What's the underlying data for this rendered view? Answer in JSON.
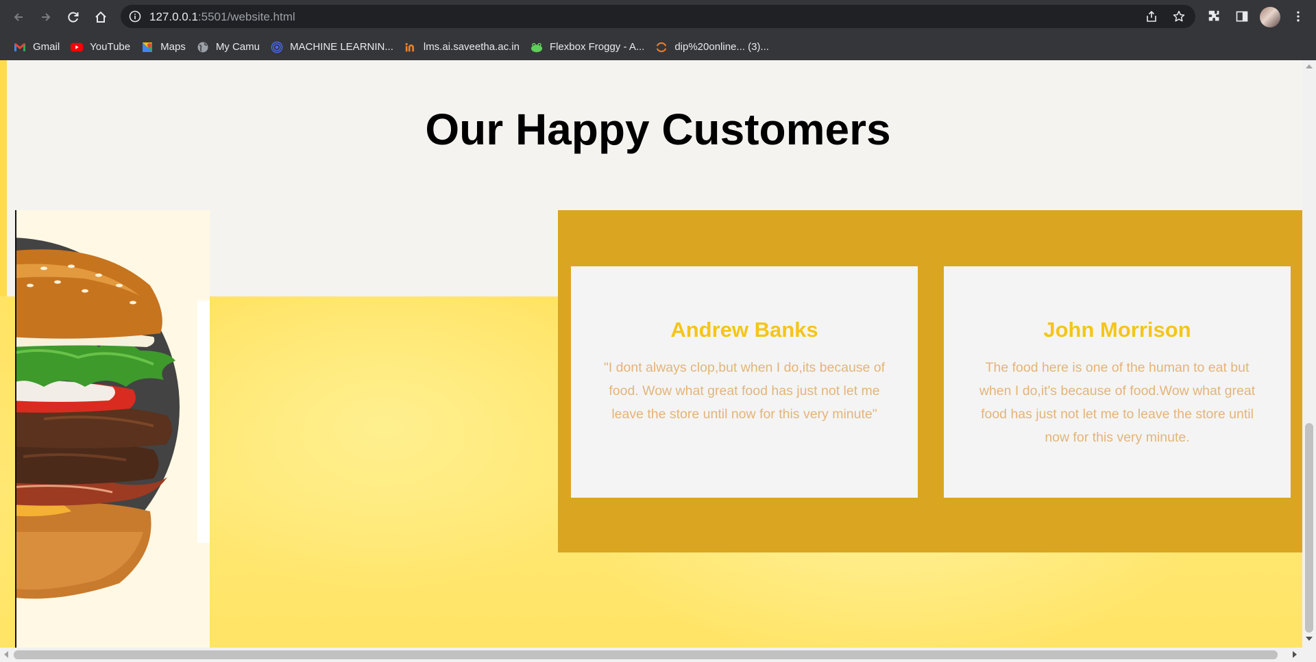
{
  "browser": {
    "url_host": "127.0.0.1",
    "url_rest": ":5501/website.html",
    "bookmarks": [
      {
        "label": "Gmail",
        "icon": "gmail-icon"
      },
      {
        "label": "YouTube",
        "icon": "youtube-icon"
      },
      {
        "label": "Maps",
        "icon": "maps-icon"
      },
      {
        "label": "My Camu",
        "icon": "globe-icon"
      },
      {
        "label": "MACHINE LEARNIN...",
        "icon": "target-icon"
      },
      {
        "label": "lms.ai.saveetha.ac.in",
        "icon": "saveetha-icon"
      },
      {
        "label": "Flexbox Froggy - A...",
        "icon": "frog-icon"
      },
      {
        "label": "dip%20online... (3)...",
        "icon": "orange-arc-icon"
      }
    ]
  },
  "page": {
    "heading": "Our Happy Customers",
    "testimonials": [
      {
        "name": "Andrew Banks",
        "quote": "\"I dont always clop,but when I do,its because of food. Wow what great food has just not let me leave the store until now for this very minute\""
      },
      {
        "name": "John Morrison",
        "quote": "The food here is one of the human to eat but when I do,it's because of food.Wow what great food has just not let me to leave the store until now for this very minute."
      }
    ]
  },
  "colors": {
    "gold_panel": "#daa520",
    "accent_name": "#f5c518",
    "quote_text": "#e4b478",
    "yellow_bg": "#ffe364",
    "page_bg": "#f4f3f0"
  }
}
